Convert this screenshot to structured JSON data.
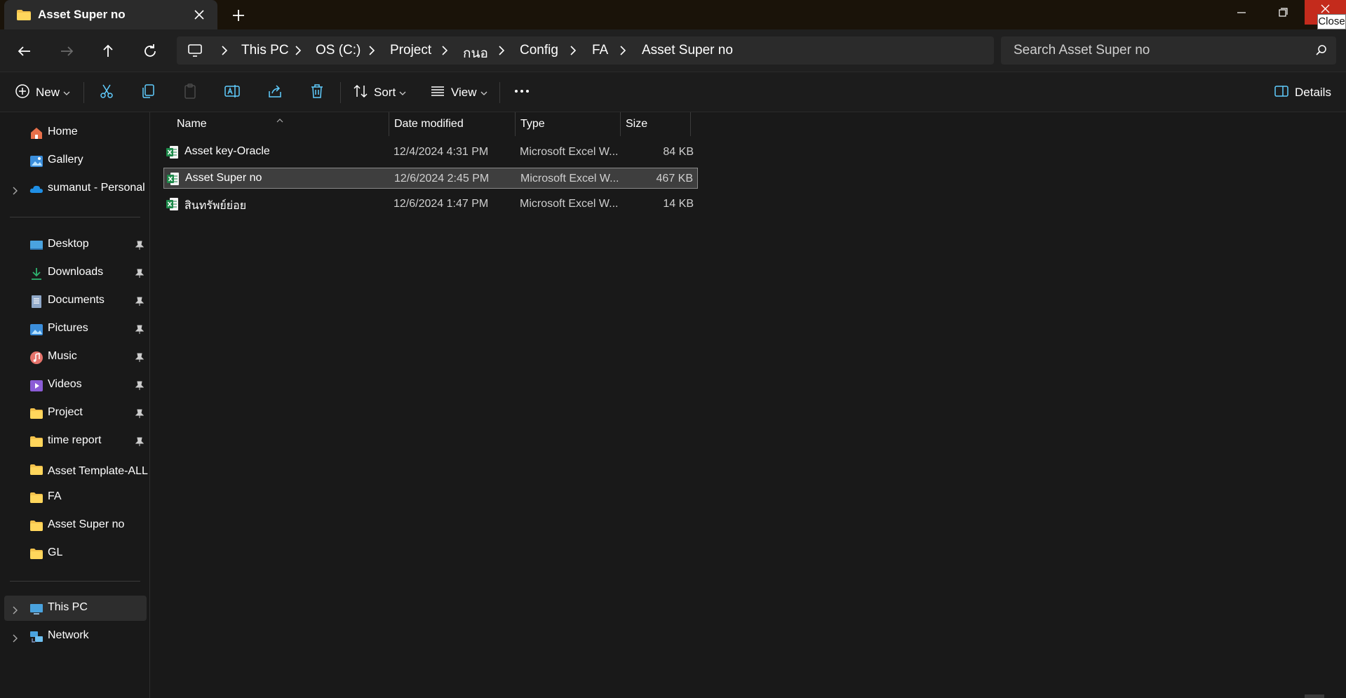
{
  "window": {
    "tab_title": "Asset Super no",
    "tooltip": "Close"
  },
  "address": {
    "breadcrumb": [
      "This PC",
      "OS (C:)",
      "Project",
      "กนอ",
      "Config",
      "FA",
      "Asset Super no"
    ],
    "search_placeholder": "Search Asset Super no"
  },
  "toolbar": {
    "new_label": "New",
    "sort_label": "Sort",
    "view_label": "View",
    "details_label": "Details"
  },
  "sidebar": {
    "top": [
      {
        "label": "Home",
        "icon": "home-icon"
      },
      {
        "label": "Gallery",
        "icon": "gallery-icon"
      },
      {
        "label": "sumanut - Personal",
        "icon": "onedrive-cloud-icon"
      }
    ],
    "quick_access": [
      {
        "label": "Desktop",
        "icon": "desktop-icon",
        "pinned": true
      },
      {
        "label": "Downloads",
        "icon": "download-icon",
        "pinned": true
      },
      {
        "label": "Documents",
        "icon": "documents-icon",
        "pinned": true
      },
      {
        "label": "Pictures",
        "icon": "pictures-icon",
        "pinned": true
      },
      {
        "label": "Music",
        "icon": "music-icon",
        "pinned": true
      },
      {
        "label": "Videos",
        "icon": "videos-icon",
        "pinned": true
      },
      {
        "label": "Project",
        "icon": "folder-icon",
        "pinned": true
      },
      {
        "label": "time report",
        "icon": "folder-icon",
        "pinned": true
      },
      {
        "label": "Asset Template-ALL สิ",
        "icon": "folder-icon",
        "pinned": false
      },
      {
        "label": "FA",
        "icon": "folder-icon",
        "pinned": false
      },
      {
        "label": "Asset Super no",
        "icon": "folder-icon",
        "pinned": false
      },
      {
        "label": "GL",
        "icon": "folder-icon",
        "pinned": false
      }
    ],
    "devices": [
      {
        "label": "This PC",
        "icon": "pc-icon",
        "selected": true
      },
      {
        "label": "Network",
        "icon": "network-icon",
        "selected": false
      }
    ]
  },
  "file_list": {
    "columns": [
      "Name",
      "Date modified",
      "Type",
      "Size"
    ],
    "rows": [
      {
        "name": "Asset key-Oracle",
        "date": "12/4/2024 4:31 PM",
        "type": "Microsoft Excel W...",
        "size": "84 KB",
        "selected": false
      },
      {
        "name": "Asset Super no",
        "date": "12/6/2024 2:45 PM",
        "type": "Microsoft Excel W...",
        "size": "467 KB",
        "selected": true
      },
      {
        "name": "สินทรัพย์ย่อย",
        "date": "12/6/2024 1:47 PM",
        "type": "Microsoft Excel W...",
        "size": "14 KB",
        "selected": false
      }
    ]
  },
  "colors": {
    "accent_close": "#c42b1c",
    "folder_yellow": "#f3c24c",
    "excel_green": "#1d8a4a"
  }
}
